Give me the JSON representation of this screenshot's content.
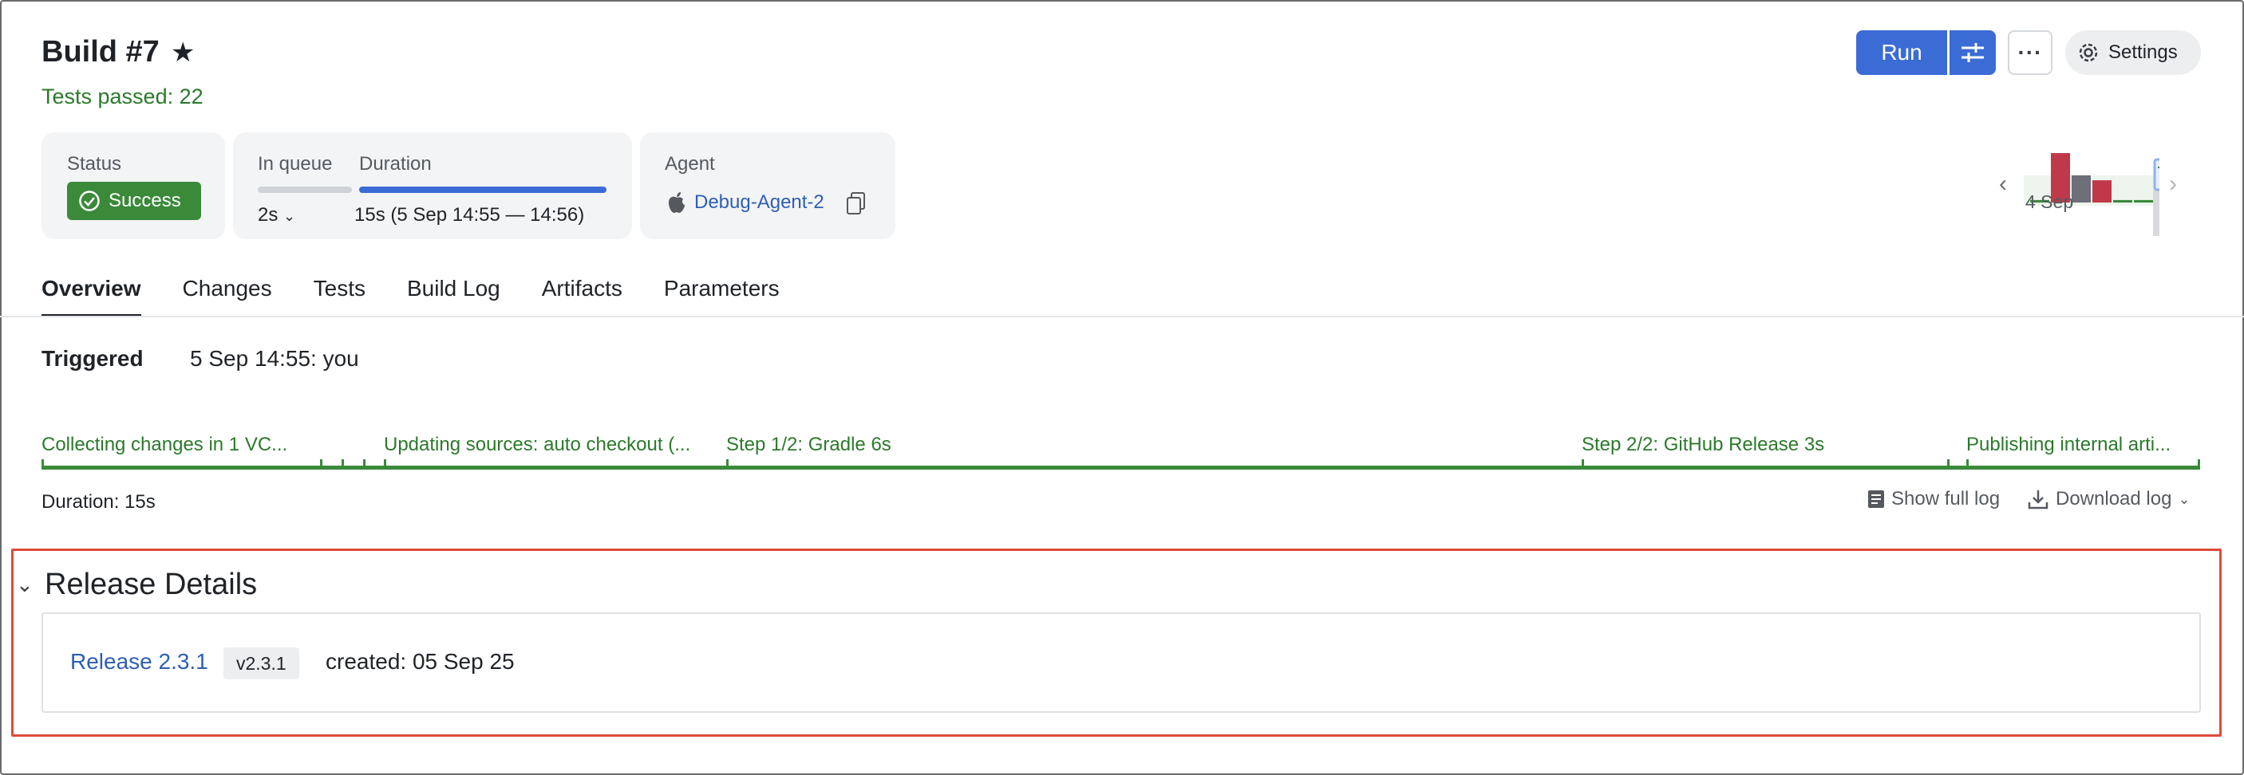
{
  "build": {
    "title": "Build #7",
    "star_icon": "star-icon",
    "tests_passed": "Tests passed: 22"
  },
  "toolbar": {
    "run_label": "Run",
    "options_icon": "sliders-icon",
    "more_label": "···",
    "settings_label": "Settings",
    "settings_icon": "gear-icon",
    "accent_color": "#3b6cd6"
  },
  "status": {
    "label": "Status",
    "value": "Success",
    "color": "#3a8a3a"
  },
  "queue": {
    "label": "In queue",
    "value": "2s"
  },
  "duration": {
    "label": "Duration",
    "value": "15s (5 Sep 14:55 — 14:56)"
  },
  "agent": {
    "label": "Agent",
    "name": "Debug-Agent-2",
    "os_icon": "apple-icon",
    "copy_icon": "copy-icon"
  },
  "history": {
    "date": "4 Sep",
    "bars": [
      {
        "status": "success",
        "value": 0.05
      },
      {
        "status": "failed",
        "value": 1.0
      },
      {
        "status": "cancelled",
        "value": 0.55
      },
      {
        "status": "failed",
        "value": 0.45
      },
      {
        "status": "success",
        "value": 0.05
      },
      {
        "status": "success",
        "value": 0.05
      },
      {
        "status": "current",
        "value": 0.5
      }
    ]
  },
  "tabs": [
    "Overview",
    "Changes",
    "Tests",
    "Build Log",
    "Artifacts",
    "Parameters"
  ],
  "triggered": {
    "label": "Triggered",
    "value": "5 Sep 14:55: you"
  },
  "timeline": {
    "steps": [
      "Collecting changes in 1 VC...",
      "Updating sources: auto checkout (...",
      "Step 1/2: Gradle 6s",
      "Step 2/2: GitHub Release 3s",
      "Publishing internal arti..."
    ]
  },
  "log": {
    "duration": "Duration: 15s",
    "show_full": "Show full log",
    "download": "Download log"
  },
  "release": {
    "section_title": "Release Details",
    "link": "Release 2.3.1",
    "tag": "v2.3.1",
    "created": "created: 05 Sep 25"
  }
}
